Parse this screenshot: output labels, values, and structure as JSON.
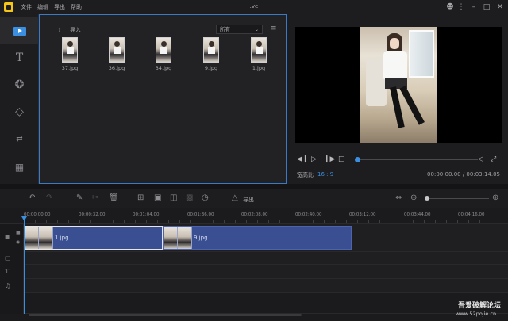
{
  "titlebar": {
    "title": ".ve",
    "menu": [
      "文件",
      "编辑",
      "导出",
      "帮助"
    ]
  },
  "media": {
    "import_label": "导入",
    "filter": "所有",
    "items": [
      {
        "label": "37.jpg"
      },
      {
        "label": "36.jpg"
      },
      {
        "label": "34.jpg"
      },
      {
        "label": "9.jpg"
      },
      {
        "label": "1.jpg"
      }
    ]
  },
  "preview": {
    "aspect_label": "宽高比",
    "aspect_value": "16 : 9",
    "timecode": "00:00:00.00 / 00:03:14.05",
    "progress": 0.0
  },
  "timeline": {
    "export_label": "导出",
    "ruler": [
      "00:00:00.00",
      "00:00:32.00",
      "00:01:04.00",
      "00:01:36.00",
      "00:02:08.00",
      "00:02:40.00",
      "00:03:12.00",
      "00:03:44.00",
      "00:04:16.00"
    ],
    "clips": [
      {
        "label": "1.jpg"
      },
      {
        "label": "9.jpg"
      }
    ]
  },
  "watermark": {
    "text": "吾爱破解论坛",
    "url": "www.52pojie.cn"
  },
  "colors": {
    "accent": "#3b8fe0",
    "clip": "#3a4f92"
  }
}
